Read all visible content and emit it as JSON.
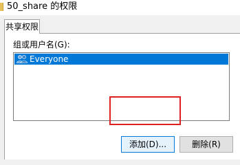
{
  "window": {
    "title": "50_share 的权限"
  },
  "tabs": [
    {
      "label": "共享权限"
    }
  ],
  "group": {
    "label": "组或用户名(G):",
    "items": [
      {
        "label": "Everyone",
        "selected": true,
        "icon": "users-icon"
      }
    ]
  },
  "buttons": {
    "add_label": "添加(D)...",
    "remove_label": "删除(R)"
  },
  "colors": {
    "selection": "#0078d7",
    "highlight_border": "#e02020"
  }
}
